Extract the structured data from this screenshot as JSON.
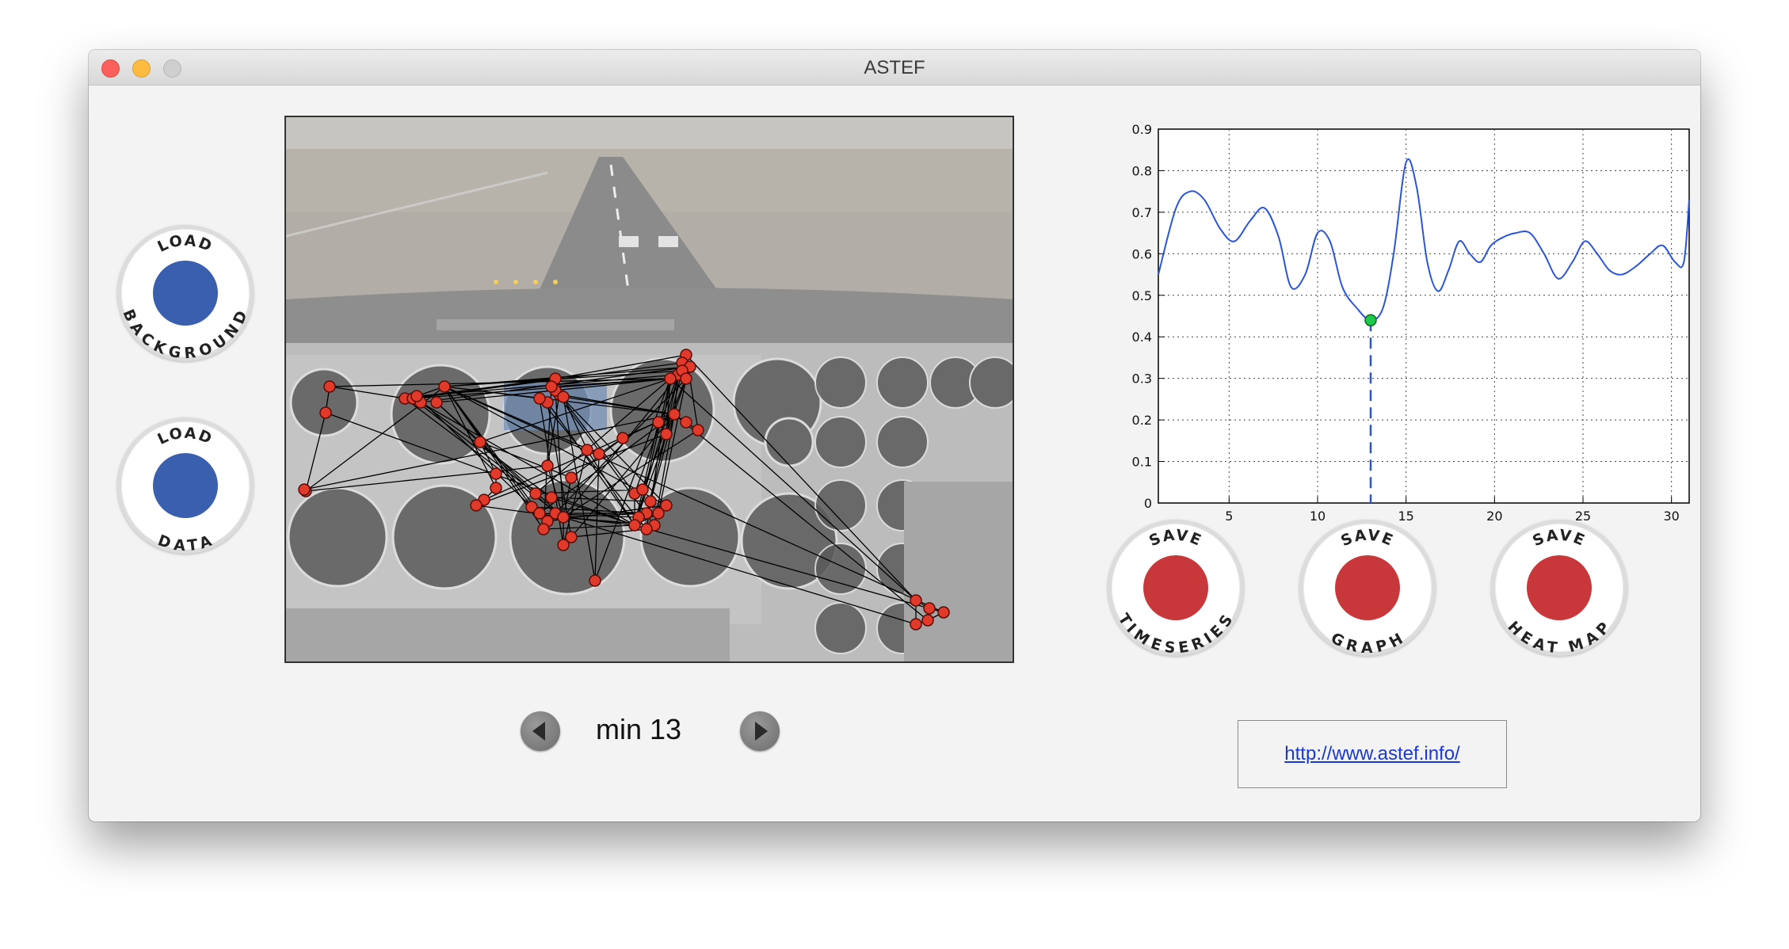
{
  "window": {
    "title": "ASTEF"
  },
  "buttons": {
    "load_background": {
      "top": "LOAD",
      "bottom": "BACKGROUND"
    },
    "load_data": {
      "top": "LOAD",
      "bottom": "DATA"
    },
    "save_timeseries": {
      "top": "SAVE",
      "bottom": "TIMESERIES"
    },
    "save_graph": {
      "top": "SAVE",
      "bottom": "GRAPH"
    },
    "save_heatmap": {
      "top": "SAVE",
      "bottom": "HEAT MAP"
    }
  },
  "navigation": {
    "label": "min 13"
  },
  "link": {
    "text": "http://www.astef.info/"
  },
  "icons": {
    "prev": "left-arrow-icon",
    "next": "right-arrow-icon"
  },
  "colors": {
    "load_dot": "#3a5fae",
    "save_dot": "#c8383a",
    "line": "#2b55d9",
    "marker": "#1fc94a",
    "gaze_point": "#e23a2a"
  },
  "chart_data": {
    "type": "line",
    "title": "",
    "xlabel": "",
    "ylabel": "",
    "xlim": [
      1,
      31
    ],
    "ylim": [
      0,
      0.9
    ],
    "xticks": [
      5,
      10,
      15,
      20,
      25,
      30
    ],
    "yticks": [
      0,
      0.1,
      0.2,
      0.3,
      0.4,
      0.5,
      0.6,
      0.7,
      0.8,
      0.9
    ],
    "grid": true,
    "series": [
      {
        "x": [
          1,
          2,
          2.8,
          3.6,
          4.5,
          5.3,
          6.2,
          7.0,
          7.8,
          8.5,
          9.3,
          10.0,
          10.7,
          11.4,
          12.2,
          13.0,
          13.7,
          14.3,
          15.0,
          15.6,
          16.2,
          16.8,
          17.4,
          18.0,
          18.6,
          19.2,
          19.8,
          20.5,
          21.2,
          22.0,
          22.8,
          23.6,
          24.4,
          25.1,
          25.8,
          26.5,
          27.2,
          28.0,
          28.8,
          29.5,
          30.2,
          30.7,
          31.0
        ],
        "y": [
          0.55,
          0.71,
          0.75,
          0.73,
          0.66,
          0.63,
          0.68,
          0.71,
          0.64,
          0.52,
          0.55,
          0.65,
          0.63,
          0.52,
          0.47,
          0.44,
          0.47,
          0.6,
          0.82,
          0.76,
          0.58,
          0.51,
          0.56,
          0.63,
          0.6,
          0.58,
          0.62,
          0.64,
          0.65,
          0.65,
          0.6,
          0.54,
          0.58,
          0.63,
          0.6,
          0.56,
          0.55,
          0.57,
          0.6,
          0.62,
          0.58,
          0.58,
          0.73
        ]
      }
    ],
    "marker": {
      "x": 13,
      "y": 0.44
    }
  }
}
